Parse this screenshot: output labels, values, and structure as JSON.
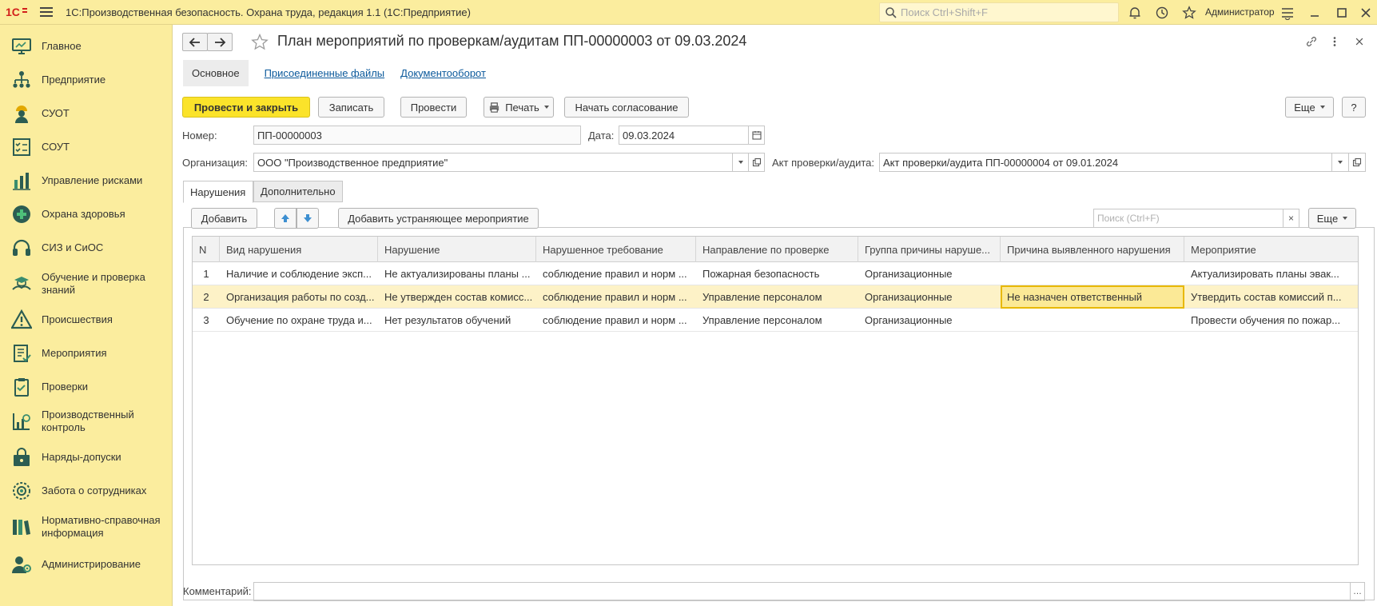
{
  "app": {
    "title": "1С:Производственная безопасность. Охрана труда, редакция 1.1  (1С:Предприятие)",
    "search_placeholder": "Поиск Ctrl+Shift+F",
    "user": "Администратор"
  },
  "sidebar": {
    "items": [
      {
        "label": "Главное",
        "icon": "monitor-icon"
      },
      {
        "label": "Предприятие",
        "icon": "org-structure-icon"
      },
      {
        "label": "СУОТ",
        "icon": "worker-icon"
      },
      {
        "label": "СОУТ",
        "icon": "checklist-icon"
      },
      {
        "label": "Управление рисками",
        "icon": "risk-chart-icon"
      },
      {
        "label": "Охрана здоровья",
        "icon": "medical-cross-icon"
      },
      {
        "label": "СИЗ и СиОС",
        "icon": "headphones-icon"
      },
      {
        "label": "Обучение и проверка знаний",
        "icon": "training-icon"
      },
      {
        "label": "Происшествия",
        "icon": "warning-icon"
      },
      {
        "label": "Мероприятия",
        "icon": "task-list-icon"
      },
      {
        "label": "Проверки",
        "icon": "inspection-icon"
      },
      {
        "label": "Производственный контроль",
        "icon": "control-chart-icon"
      },
      {
        "label": "Наряды-допуски",
        "icon": "permit-icon"
      },
      {
        "label": "Забота о сотрудниках",
        "icon": "care-icon"
      },
      {
        "label": "Нормативно-справочная информация",
        "icon": "books-icon"
      },
      {
        "label": "Администрирование",
        "icon": "admin-icon"
      }
    ]
  },
  "document": {
    "title": "План мероприятий по проверкам/аудитам ПП-00000003 от 09.03.2024",
    "tabs": {
      "main": "Основное",
      "files": "Присоединенные файлы",
      "workflow": "Документооборот"
    },
    "toolbar": {
      "post_close": "Провести и закрыть",
      "save": "Записать",
      "post": "Провести",
      "print": "Печать",
      "approval": "Начать согласование",
      "more": "Еще",
      "help": "?"
    },
    "fields": {
      "number_label": "Номер:",
      "number_value": "ПП-00000003",
      "date_label": "Дата:",
      "date_value": "09.03.2024",
      "org_label": "Организация:",
      "org_value": "ООО \"Производственное предприятие\"",
      "act_label": "Акт проверки/аудита:",
      "act_value": "Акт проверки/аудита ПП-00000004 от 09.01.2024"
    },
    "inner_tabs": {
      "violations": "Нарушения",
      "additional": "Дополнительно"
    },
    "table_toolbar": {
      "add": "Добавить",
      "add_measure": "Добавить устраняющее мероприятие",
      "search_placeholder": "Поиск (Ctrl+F)",
      "clear": "×",
      "more": "Еще"
    },
    "table": {
      "columns": [
        "N",
        "Вид нарушения",
        "Нарушение",
        "Нарушенное требование",
        "Направление по проверке",
        "Группа причины наруше...",
        "Причина выявленного нарушения",
        "Мероприятие"
      ],
      "rows": [
        [
          "1",
          "Наличие и соблюдение эксп...",
          "Не актуализированы планы ...",
          "соблюдение правил и норм ...",
          "Пожарная безопасность",
          "Организационные",
          "",
          "Актуализировать планы эвак..."
        ],
        [
          "2",
          "Организация работы по созд...",
          "Не утвержден состав комисс...",
          "соблюдение правил и норм ...",
          "Управление персоналом",
          "Организационные",
          "Не назначен ответственный",
          "Утвердить состав комиссий п..."
        ],
        [
          "3",
          "Обучение по охране труда и...",
          "Нет результатов обучений",
          "соблюдение правил и норм ...",
          "Управление персоналом",
          "Организационные",
          "",
          "Провести обучения по пожар..."
        ]
      ]
    },
    "comment_label": "Комментарий:",
    "comment_value": ""
  }
}
